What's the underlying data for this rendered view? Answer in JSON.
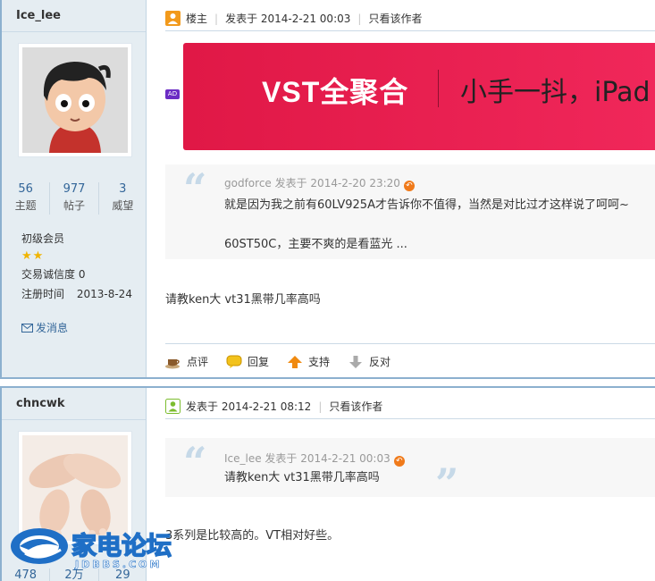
{
  "post1": {
    "author": "Ice_lee",
    "stats": [
      {
        "num": "56",
        "label": "主题"
      },
      {
        "num": "977",
        "label": "帖子"
      },
      {
        "num": "3",
        "label": "威望"
      }
    ],
    "rank": "初级会员",
    "stars": "★★",
    "credit_label": "交易诚信度",
    "credit_value": "0",
    "reg_label": "注册时间",
    "reg_date": "2013-8-24",
    "send_msg": "发消息",
    "floor_label": "楼主",
    "posted": "发表于 2014-2-21 00:03",
    "only_author": "只看该作者",
    "ad_tag": "AD",
    "banner_logo": "VST全聚合",
    "banner_slogan": "小手一抖，iPad m",
    "quote": {
      "head": "godforce 发表于 2014-2-20 23:20",
      "line1": "就是因为我之前有60LV925A才告诉你不值得，当然是对比过才这样说了呵呵~",
      "line2": "60ST50C，主要不爽的是看蓝光 ..."
    },
    "body": "请教ken大 vt31黑带几率高吗",
    "actions": [
      "点评",
      "回复",
      "支持",
      "反对"
    ]
  },
  "post2": {
    "author": "chncwk",
    "stats": [
      {
        "num": "478"
      },
      {
        "num": "2万"
      },
      {
        "num": "29"
      }
    ],
    "posted": "发表于 2014-2-21 08:12",
    "only_author": "只看该作者",
    "quote": {
      "head": "Ice_lee 发表于 2014-2-21 00:03",
      "line1": "请教ken大 vt31黑带几率高吗"
    },
    "body": "3系列是比较高的。VT相对好些。"
  },
  "watermark": {
    "name": "家电论坛",
    "domain": "JDBBS.COM"
  },
  "colors": {
    "border": "#8cb0cf",
    "sidebar": "#e5edf2",
    "link": "#336699",
    "banner": "#e01846"
  }
}
